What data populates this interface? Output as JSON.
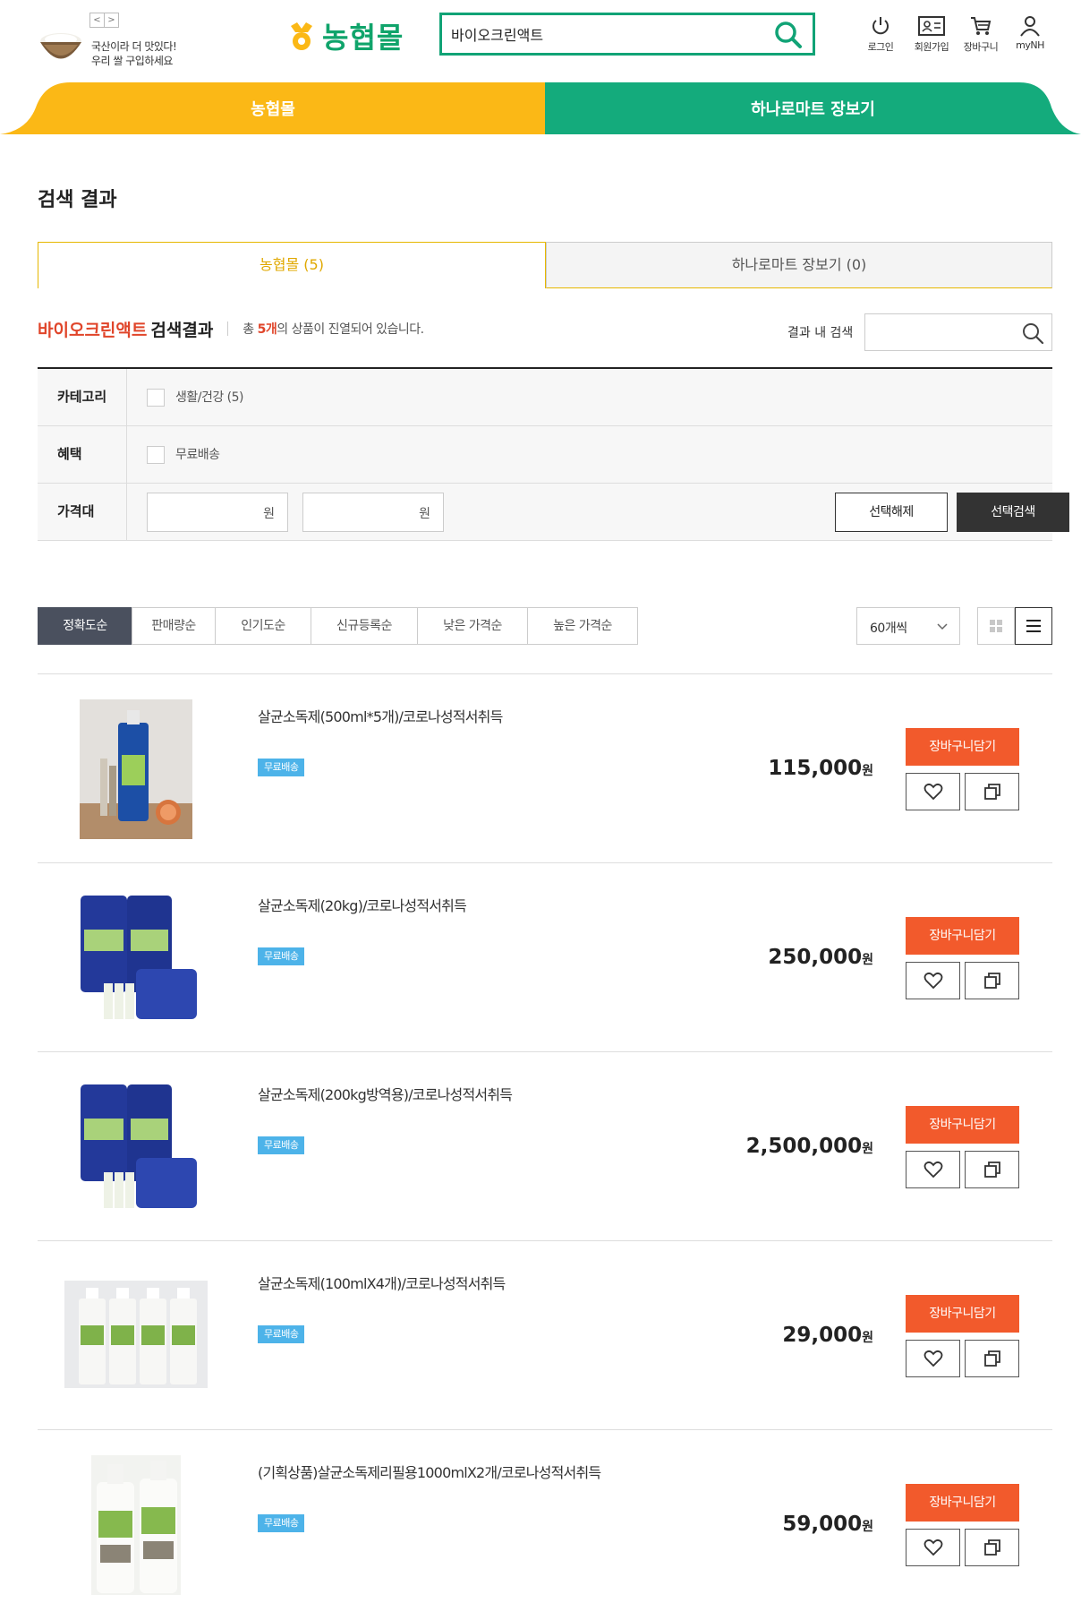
{
  "header": {
    "promo_line1": "국산이라 더 맛있다!",
    "promo_line2": "우리 쌀 구입하세요",
    "promo_prev": "<",
    "promo_next": ">",
    "logo_text": "농협몰",
    "search_value": "바이오크린액트",
    "utils": [
      {
        "label": "로그인",
        "icon": "power-icon"
      },
      {
        "label": "회원가입",
        "icon": "member-card-icon"
      },
      {
        "label": "장바구니",
        "icon": "cart-icon"
      },
      {
        "label": "myNH",
        "icon": "person-icon"
      }
    ]
  },
  "nav": {
    "left_label": "농협몰",
    "right_label": "하나로마트 장보기",
    "left_color": "#fbb816",
    "right_color": "#14ab7c"
  },
  "page_title": "검색 결과",
  "tabs": [
    {
      "label": "농협몰 (5)",
      "active": true
    },
    {
      "label": "하나로마트 장보기 (0)",
      "active": false
    }
  ],
  "result": {
    "keyword": "바이오크린액트",
    "keyword_suffix": "검색결과",
    "count_prefix": "총 ",
    "count_value": "5개",
    "count_suffix": "의 상품이 진열되어 있습니다.",
    "in_result_label": "결과 내 검색"
  },
  "filters": {
    "category_head": "카테고리",
    "category_option": "생활/건강 (5)",
    "benefit_head": "혜택",
    "benefit_option": "무료배송",
    "price_head": "가격대",
    "price_unit": "원",
    "price_tilde": "~",
    "reset_label": "선택해제",
    "search_label": "선택검색"
  },
  "sort": {
    "items": [
      "정확도순",
      "판매량순",
      "인기도순",
      "신규등록순",
      "낮은 가격순",
      "높은 가격순"
    ],
    "per_page": "60개씩"
  },
  "products": [
    {
      "name": "살균소독제(500ml*5개)/코로나성적서취득",
      "badge": "무료배송",
      "price": "115,000",
      "won": "원",
      "cart": "장바구니담기"
    },
    {
      "name": "살균소독제(20kg)/코로나성적서취득",
      "badge": "무료배송",
      "price": "250,000",
      "won": "원",
      "cart": "장바구니담기"
    },
    {
      "name": "살균소독제(200kg방역용)/코로나성적서취득",
      "badge": "무료배송",
      "price": "2,500,000",
      "won": "원",
      "cart": "장바구니담기"
    },
    {
      "name": "살균소독제(100mlX4개)/코로나성적서취득",
      "badge": "무료배송",
      "price": "29,000",
      "won": "원",
      "cart": "장바구니담기"
    },
    {
      "name": "(기획상품)살균소독제리필용1000mlX2개/코로나성적서취득",
      "badge": "무료배송",
      "price": "59,000",
      "won": "원",
      "cart": "장바구니담기"
    }
  ],
  "colors": {
    "brand_green": "#11a376",
    "accent_orange": "#f25a2c",
    "keyword_red": "#e0452a",
    "badge_blue": "#4db3e9",
    "tab_gold": "#e0a800"
  }
}
